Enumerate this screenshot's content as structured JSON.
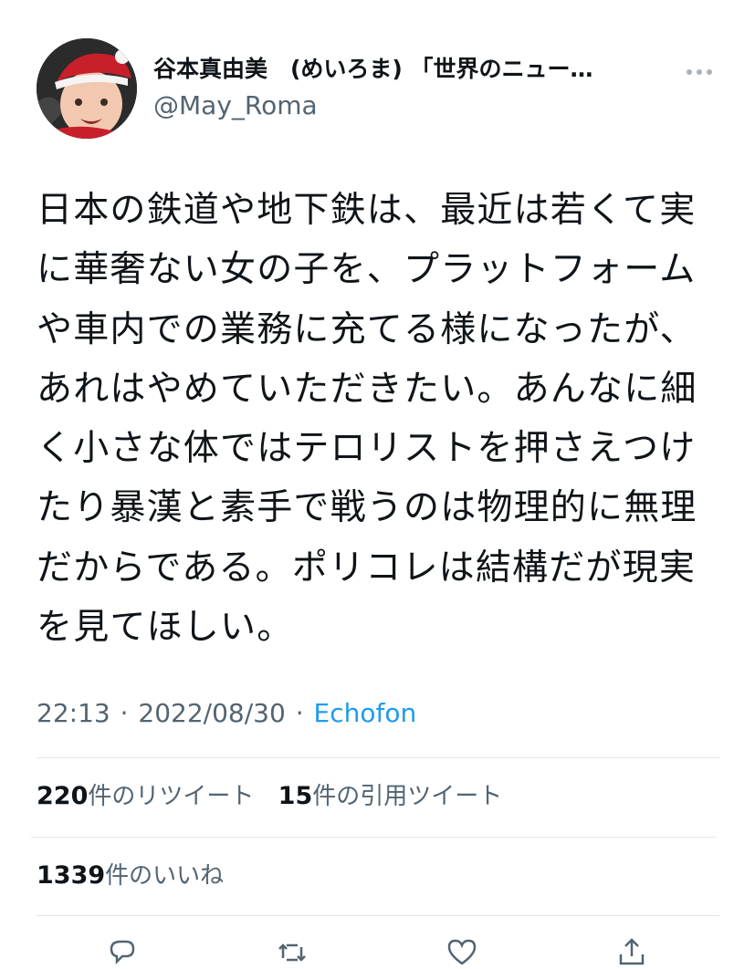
{
  "author": {
    "display_name": "谷本真由美　(めいろま) 「世界のニュー…",
    "handle": "@May_Roma",
    "avatar_icon": "baby-in-santa-hat-avatar"
  },
  "menu": {
    "icon": "more-options-icon"
  },
  "tweet": {
    "text": "日本の鉄道や地下鉄は、最近は若くて実に華奢ない女の子を、プラットフォームや車内での業務に充てる様になったが、あれはやめていただきたい。あんなに細く小さな体ではテロリストを押さえつけたり暴漢と素手で戦うのは物理的に無理だからである。ポリコレは結構だが現実を見てほしい。"
  },
  "meta": {
    "time": "22:13",
    "separator": "·",
    "date": "2022/08/30",
    "source": "Echofon"
  },
  "stats": {
    "retweets_count": "220",
    "retweets_label": "件のリツイート",
    "quotes_count": "15",
    "quotes_label": "件の引用ツイート",
    "likes_count": "1339",
    "likes_label": "件のいいね"
  },
  "actions": [
    {
      "icon": "reply-icon"
    },
    {
      "icon": "retweet-icon"
    },
    {
      "icon": "like-icon"
    },
    {
      "icon": "share-icon"
    }
  ],
  "colors": {
    "text_primary": "#0f1419",
    "text_secondary": "#536471",
    "link": "#1d9bf0",
    "divider": "#e1e6ea"
  }
}
